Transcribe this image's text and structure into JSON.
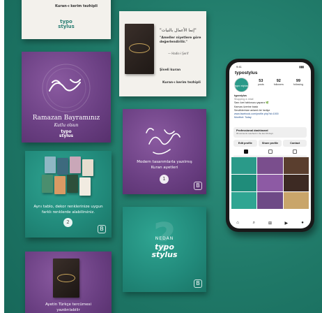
{
  "cards": {
    "top_left": {
      "text": "Kuran-ı kerim tezhipli",
      "brand_line1": "typo",
      "brand_line2": "stylus"
    },
    "top_mid": {
      "arabic_quote": "\"إنما الأعمال بالنيات\"",
      "quote_tr": "\"Ameller niyetlere göre değerlendirilir.\"",
      "quote_src": "— Hadis-i Şerif",
      "foot_1": "Şiveli kuran",
      "foot_2": "Kuran-ı kerim tezhipli"
    },
    "ramazan": {
      "title": "Ramazan Bayramınız",
      "subtitle": "Kutlu olsun",
      "brand_line1": "typo",
      "brand_line2": "stylus"
    },
    "modern": {
      "caption": "Modern tasarımlarla yazılmış Kuran ayetleri",
      "number": "1"
    },
    "teal_books": {
      "caption": "Aynı tablo, dekor renklerinize uygun farklı renklerde alabilirsiniz.",
      "number": "2"
    },
    "nedan": {
      "top": "NEDAN",
      "brand_line1": "typo",
      "brand_line2": "stylus"
    },
    "bottom_left": {
      "caption": "Ayetin Türkçe tercümesi yazdırılabilir"
    }
  },
  "instagram": {
    "status_time": "9:41",
    "username": "typostylus",
    "avatar_text": "typo stylus",
    "stats": [
      {
        "value": "53",
        "label": "posts"
      },
      {
        "value": "92",
        "label": "followers"
      },
      {
        "value": "99",
        "label": "following"
      }
    ],
    "bio": {
      "name": "typostylus",
      "line1": "Shopping & retail",
      "line2": "Sanı özel tablonuzu yaparız 🌿",
      "line3": "Kanvas üzerine baskı",
      "line4": "Sevdiklerinize anlamlı bir hediye",
      "link": "www.facebook.com/profile.php?id=1000",
      "link2": "Montfort: Today"
    },
    "dashboard": {
      "title": "Professional dashboard",
      "sub": "99 accounts reached in the last 30 days"
    },
    "buttons": [
      "Edit profile",
      "Share profile",
      "Contact"
    ],
    "grid_colors": [
      "#2a9a89",
      "#7a4e8d",
      "#5a3e2e",
      "#1f8c7a",
      "#8d5aa4",
      "#3d2a23",
      "#2fa592",
      "#6e4a86",
      "#c9a56a"
    ],
    "nav_icons": [
      "home-icon",
      "search-icon",
      "add-icon",
      "reels-icon",
      "profile-icon"
    ]
  },
  "colors": {
    "background": "#1f7867",
    "purple": "#6a3f82",
    "teal": "#21897a"
  }
}
